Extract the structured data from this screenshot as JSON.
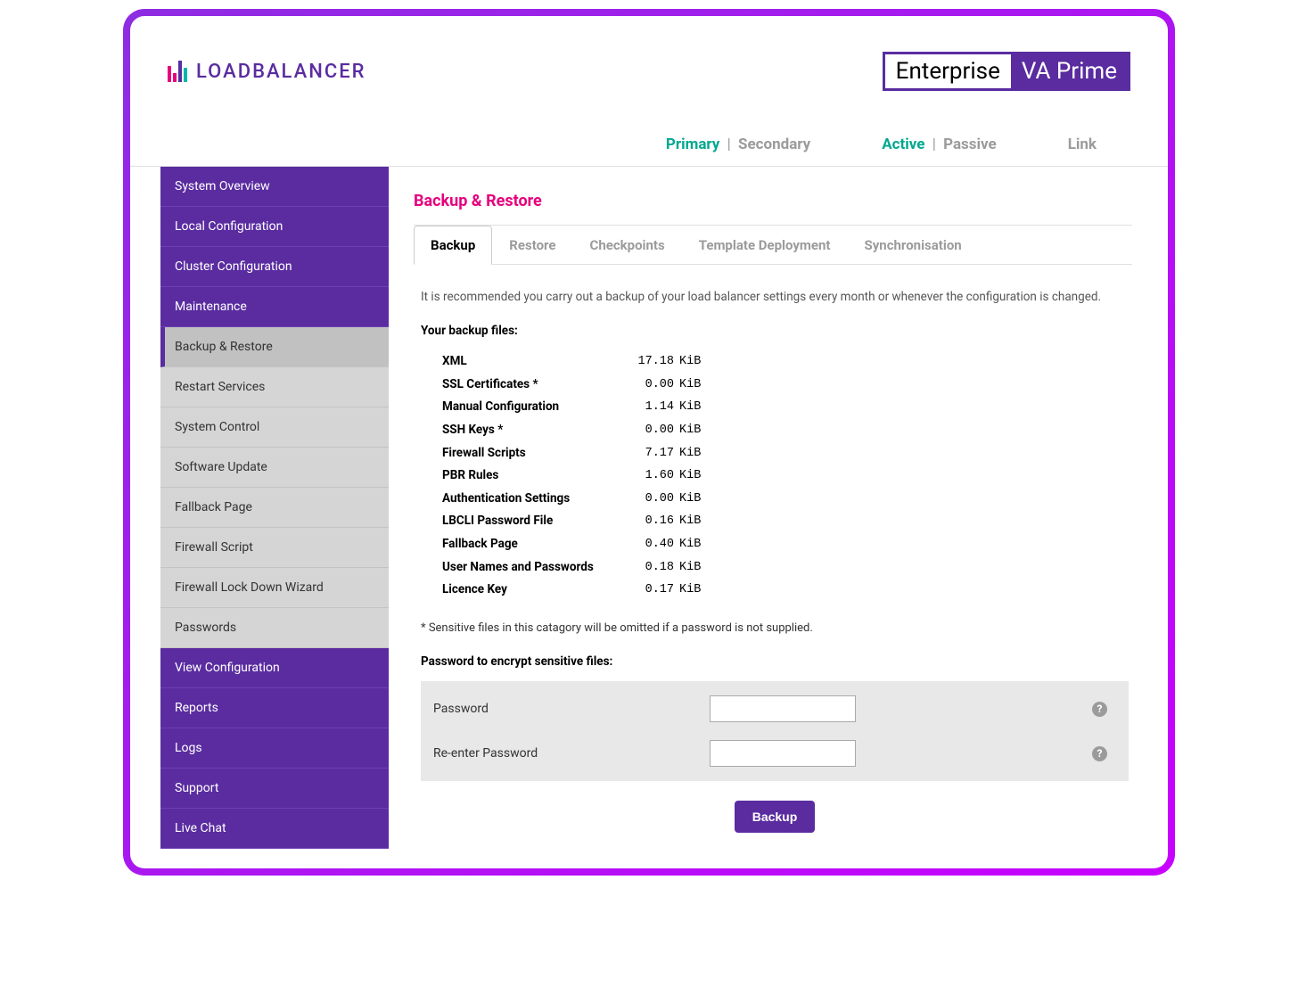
{
  "logo_text": "LOADBALANCER",
  "badge": {
    "left": "Enterprise",
    "right": "VA Prime"
  },
  "status": {
    "primary": "Primary",
    "secondary": "Secondary",
    "active": "Active",
    "passive": "Passive",
    "link": "Link"
  },
  "sidebar": {
    "system_overview": "System Overview",
    "local_config": "Local Configuration",
    "cluster_config": "Cluster Configuration",
    "maintenance": "Maintenance",
    "sub": {
      "backup_restore": "Backup & Restore",
      "restart_services": "Restart Services",
      "system_control": "System Control",
      "software_update": "Software Update",
      "fallback_page": "Fallback Page",
      "firewall_script": "Firewall Script",
      "firewall_lockdown": "Firewall Lock Down Wizard",
      "passwords": "Passwords"
    },
    "view_config": "View Configuration",
    "reports": "Reports",
    "logs": "Logs",
    "support": "Support",
    "live_chat": "Live Chat"
  },
  "page_title": "Backup & Restore",
  "tabs": {
    "backup": "Backup",
    "restore": "Restore",
    "checkpoints": "Checkpoints",
    "template": "Template Deployment",
    "sync": "Synchronisation"
  },
  "info_text": "It is recommended you carry out a backup of your load balancer settings every month or whenever the configuration is changed.",
  "files_label": "Your backup files:",
  "files": [
    {
      "name": "XML",
      "size": "17.18",
      "unit": "KiB"
    },
    {
      "name": "SSL Certificates *",
      "size": "0.00",
      "unit": "KiB"
    },
    {
      "name": "Manual Configuration",
      "size": "1.14",
      "unit": "KiB"
    },
    {
      "name": "SSH Keys *",
      "size": "0.00",
      "unit": "KiB"
    },
    {
      "name": "Firewall Scripts",
      "size": "7.17",
      "unit": "KiB"
    },
    {
      "name": "PBR Rules",
      "size": "1.60",
      "unit": "KiB"
    },
    {
      "name": "Authentication Settings",
      "size": "0.00",
      "unit": "KiB"
    },
    {
      "name": "LBCLI Password File",
      "size": "0.16",
      "unit": "KiB"
    },
    {
      "name": "Fallback Page",
      "size": "0.40",
      "unit": "KiB"
    },
    {
      "name": "User Names and Passwords",
      "size": "0.18",
      "unit": "KiB"
    },
    {
      "name": "Licence Key",
      "size": "0.17",
      "unit": "KiB"
    }
  ],
  "sensitive_note": "* Sensitive files in this catagory will be omitted if a password is not supplied.",
  "encrypt_label": "Password to encrypt sensitive files:",
  "form": {
    "password_label": "Password",
    "reenter_label": "Re-enter Password"
  },
  "backup_button": "Backup"
}
